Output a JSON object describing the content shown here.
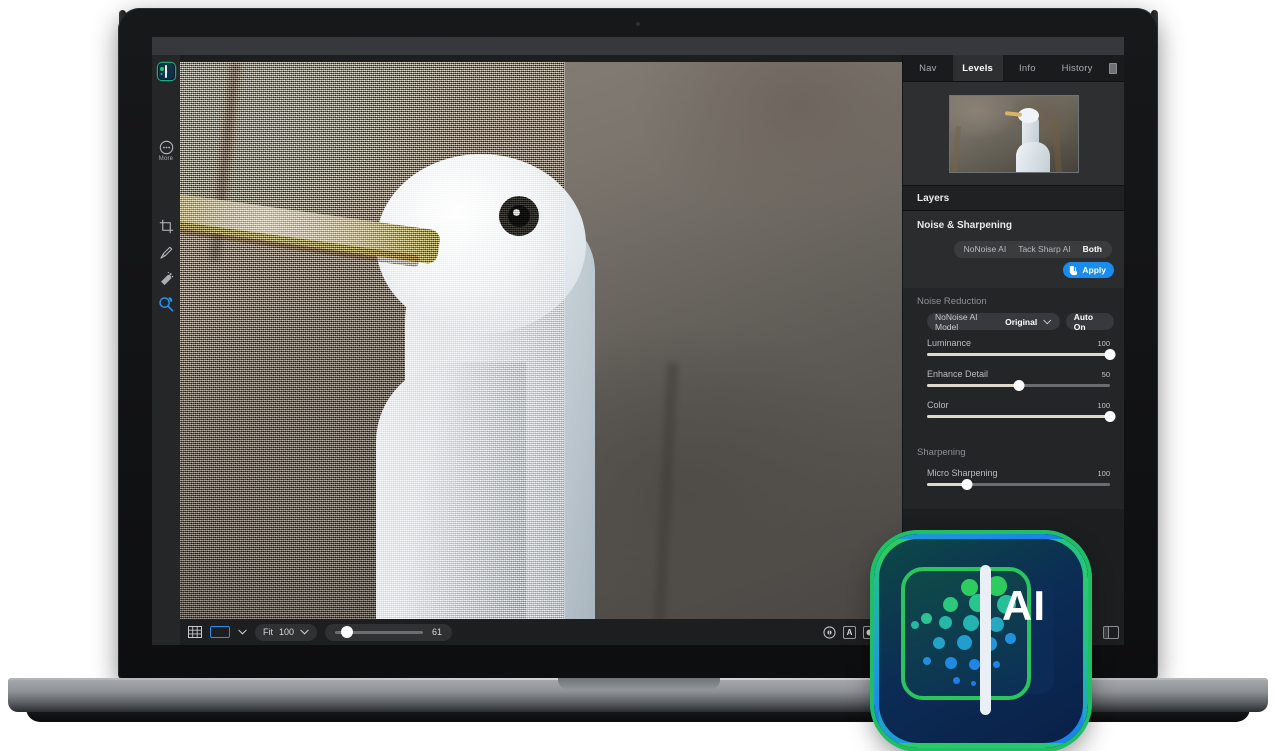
{
  "app": {
    "logo_name": "ai-photo-app-icon",
    "logo_text": "AI"
  },
  "left_rail": {
    "items": [
      {
        "name": "app-logo",
        "label": ""
      },
      {
        "name": "more",
        "label": "More"
      },
      {
        "name": "crop-tool",
        "label": ""
      },
      {
        "name": "retouch-brush-tool",
        "label": ""
      },
      {
        "name": "healing-tool",
        "label": ""
      },
      {
        "name": "zoom-tool",
        "label": ""
      }
    ]
  },
  "canvas": {
    "view_mode": "split-before-after",
    "left_label": "",
    "right_label": ""
  },
  "toolbar": {
    "grid_icon": "grid-icon",
    "view_rect_icon": "single-view-icon",
    "chevron_icon": "chevron-down-icon",
    "fit_label": "Fit",
    "fit_value": "100",
    "zoom_value": "61",
    "eye_icon": "eye-icon",
    "a_badge": "A",
    "mask_icon": "mask-icon",
    "trailing_chevron": "chevron-down-icon",
    "panel_toggle_icon": "split-panel-icon"
  },
  "right_panel": {
    "tabs": [
      {
        "label": "Nav",
        "active": false
      },
      {
        "label": "Levels",
        "active": true
      },
      {
        "label": "Info",
        "active": false
      },
      {
        "label": "History",
        "active": false
      }
    ],
    "collapse_icon": "panel-collapse-icon",
    "layers_title": "Layers",
    "noise_section_title": "Noise & Sharpening",
    "mode_segments": [
      {
        "label": "NoNoise AI",
        "active": false
      },
      {
        "label": "Tack Sharp AI",
        "active": false
      },
      {
        "label": "Both",
        "active": true
      }
    ],
    "apply_label": "Apply",
    "noise_reduction": {
      "title": "Noise Reduction",
      "model_label": "NoNoise AI Model",
      "model_value": "Original",
      "auto_label": "Auto On",
      "sliders": [
        {
          "label": "Luminance",
          "value": "100",
          "percent": 100
        },
        {
          "label": "Enhance Detail",
          "value": "50",
          "percent": 50
        },
        {
          "label": "Color",
          "value": "100",
          "percent": 100
        }
      ]
    },
    "sharpening": {
      "title": "Sharpening",
      "sliders": [
        {
          "label": "Micro Sharpening",
          "value": "100",
          "percent": 22
        }
      ]
    }
  },
  "colors": {
    "accent_blue": "#1a8cf0",
    "accent_green": "#2bc45f",
    "panel_bg": "#2a2c2e",
    "canvas_bg": "#1d1e20",
    "slider_fill": "#ded8cd"
  }
}
